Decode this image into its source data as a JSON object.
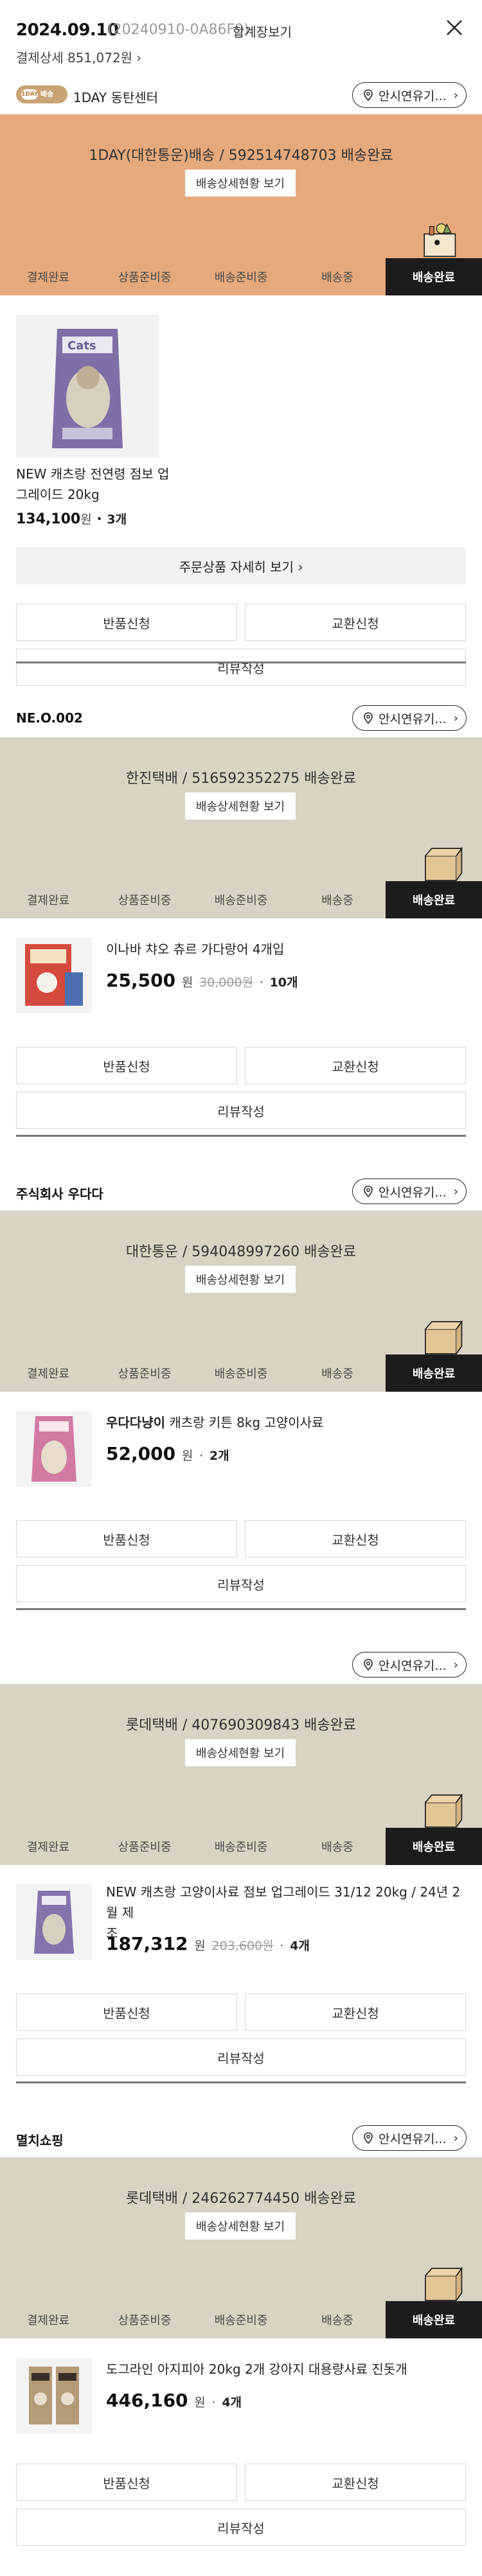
{
  "header": {
    "date": "2024.09.10",
    "order_no": "(20240910-0A86F9)",
    "combine_label": "합계장보기",
    "payment": "결제상세 851,072원",
    "payment_chevron": "›"
  },
  "common": {
    "inquiry": "안시연유기...",
    "inquiry_arrow": "›",
    "detail_button": "배송상세현황 보기",
    "return": "반품신청",
    "exchange": "교환신청",
    "review": "리뷰작성",
    "won": "원",
    "steps": [
      "결제완료",
      "상품준비중",
      "배송준비중",
      "배송중",
      "배송완료"
    ]
  },
  "colors": {
    "orange_banner": "#e5a97c",
    "beige_banner": "#d8d3c2",
    "active_step": "#1c1c1c"
  },
  "shipments": [
    {
      "seller": "1DAY 동탄센터",
      "logo_badge": "1DAY",
      "logo_text": "배송",
      "status": "1DAY(대한통운)배송 / 592514748703 배송완료",
      "product": {
        "name_line1": "NEW 캐츠랑 전연령 점보 업",
        "name_line2": "그레이드 20kg",
        "price": "134,100",
        "qty": "3개"
      },
      "more": "주문상품 자세히 보기 ›"
    },
    {
      "seller": "NE.O.002",
      "status": "한진택배 / 516592352275 배송완료",
      "product": {
        "name": "이나바 챠오 츄르 가다랑어 4개입",
        "price": "25,500",
        "orig": "30,000원",
        "qty": "10개"
      }
    },
    {
      "seller": "주식회사 우다다",
      "status": "대한통운 / 594048997260 배송완료",
      "product": {
        "brand": "우다다냥이",
        "name": "캐츠랑 키튼 8kg 고양이사료",
        "price": "52,000",
        "qty": "2개"
      }
    },
    {
      "seller": "",
      "status": "롯데택배 / 407690309843 배송완료",
      "product": {
        "name_line1": "NEW 캐츠랑 고양이사료 점보 업그레이드 31/12 20kg / 24년 2월 제",
        "name_line2": "조",
        "price": "187,312",
        "orig": "203,600원",
        "qty": "4개"
      }
    },
    {
      "seller": "멸치쇼핑",
      "status": "롯데택배 / 246262774450 배송완료",
      "product": {
        "name": "도그라인 아지피아 20kg 2개 강아지 대용량사료 진돗개",
        "price": "446,160",
        "qty": "4개"
      }
    }
  ]
}
